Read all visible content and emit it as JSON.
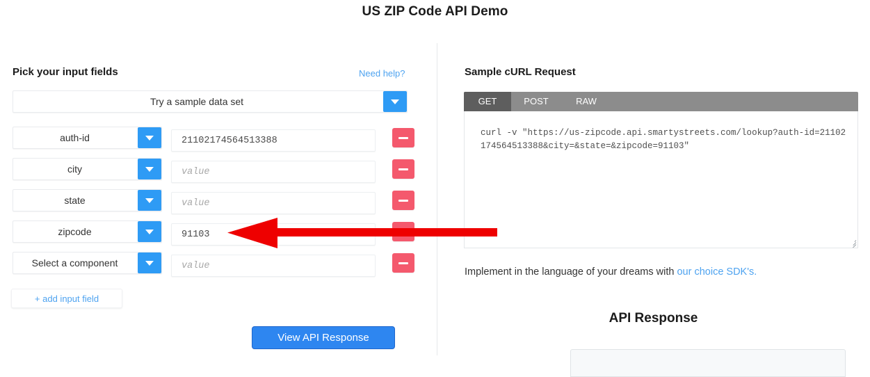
{
  "page": {
    "title": "US ZIP Code API Demo"
  },
  "left": {
    "section_heading": "Pick your input fields",
    "need_help_label": "Need help?",
    "sample_select_label": "Try a sample data set",
    "value_placeholder": "value",
    "rows": [
      {
        "component": "auth-id",
        "value": "21102174564513388",
        "remove_label": "remove"
      },
      {
        "component": "city",
        "value": "",
        "remove_label": "remove"
      },
      {
        "component": "state",
        "value": "",
        "remove_label": "remove"
      },
      {
        "component": "zipcode",
        "value": "91103",
        "remove_label": "remove"
      },
      {
        "component": "Select a component",
        "value": "",
        "remove_label": "remove"
      }
    ],
    "add_field_label": "+ add input field",
    "view_response_label": "View API Response"
  },
  "right": {
    "curl_heading": "Sample cURL Request",
    "tabs": [
      {
        "label": "GET",
        "active": true
      },
      {
        "label": "POST",
        "active": false
      },
      {
        "label": "RAW",
        "active": false
      }
    ],
    "curl_command": "curl -v \"https://us-zipcode.api.smartystreets.com/lookup?auth-id=21102174564513388&city=&state=&zipcode=91103\"",
    "implement_text": "Implement in the language of your dreams with ",
    "implement_link": "our choice SDK's.",
    "api_response_heading": "API Response"
  },
  "annotation": {
    "arrow_color": "#ee0000",
    "arrow_direction": "left"
  },
  "colors": {
    "accent_blue": "#2e9bf5",
    "button_blue": "#2e86f0",
    "remove_red": "#f4596d",
    "link_blue": "#4ea3f0",
    "tab_bar_gray": "#8c8c8c",
    "tab_active_gray": "#5e5e5e"
  }
}
